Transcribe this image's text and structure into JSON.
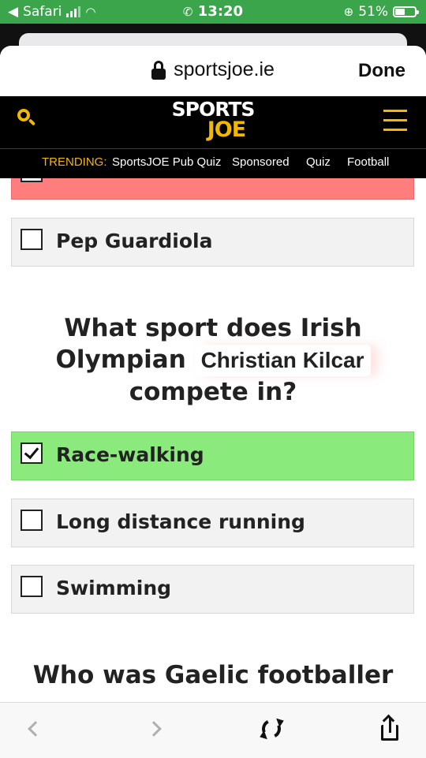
{
  "status_bar": {
    "back_app": "Safari",
    "time": "13:20",
    "battery": "51%",
    "battery_fraction": 0.51
  },
  "browser": {
    "url": "sportsjoe.ie",
    "done_label": "Done"
  },
  "site": {
    "logo_line1": "SPORTS",
    "logo_line2": "JOE",
    "accent_color": "#f2b705"
  },
  "trending": {
    "label": "TRENDING:",
    "items": [
      "SportsJOE Pub Quiz",
      "Sponsored",
      "Quiz",
      "Football"
    ]
  },
  "quiz": {
    "prev_options": [
      {
        "label": "Pep Guardiola",
        "state": "neutral"
      }
    ],
    "question": {
      "line1": "What sport does Irish",
      "line2_prefix": "Olympian",
      "name": "Christian Kilcar",
      "line3": "compete in?"
    },
    "options": [
      {
        "label": "Race-walking",
        "state": "correct",
        "checked": true
      },
      {
        "label": "Long distance running",
        "state": "neutral",
        "checked": false
      },
      {
        "label": "Swimming",
        "state": "neutral",
        "checked": false
      }
    ],
    "next_question_partial": "Who was Gaelic footballer"
  },
  "toolbar": {
    "icons": [
      "back-icon",
      "forward-icon",
      "refresh-icon",
      "share-icon"
    ]
  },
  "colors": {
    "status_green": "#3aa54a",
    "correct": "#8aeb7c",
    "wrong": "#ff7d7d"
  }
}
